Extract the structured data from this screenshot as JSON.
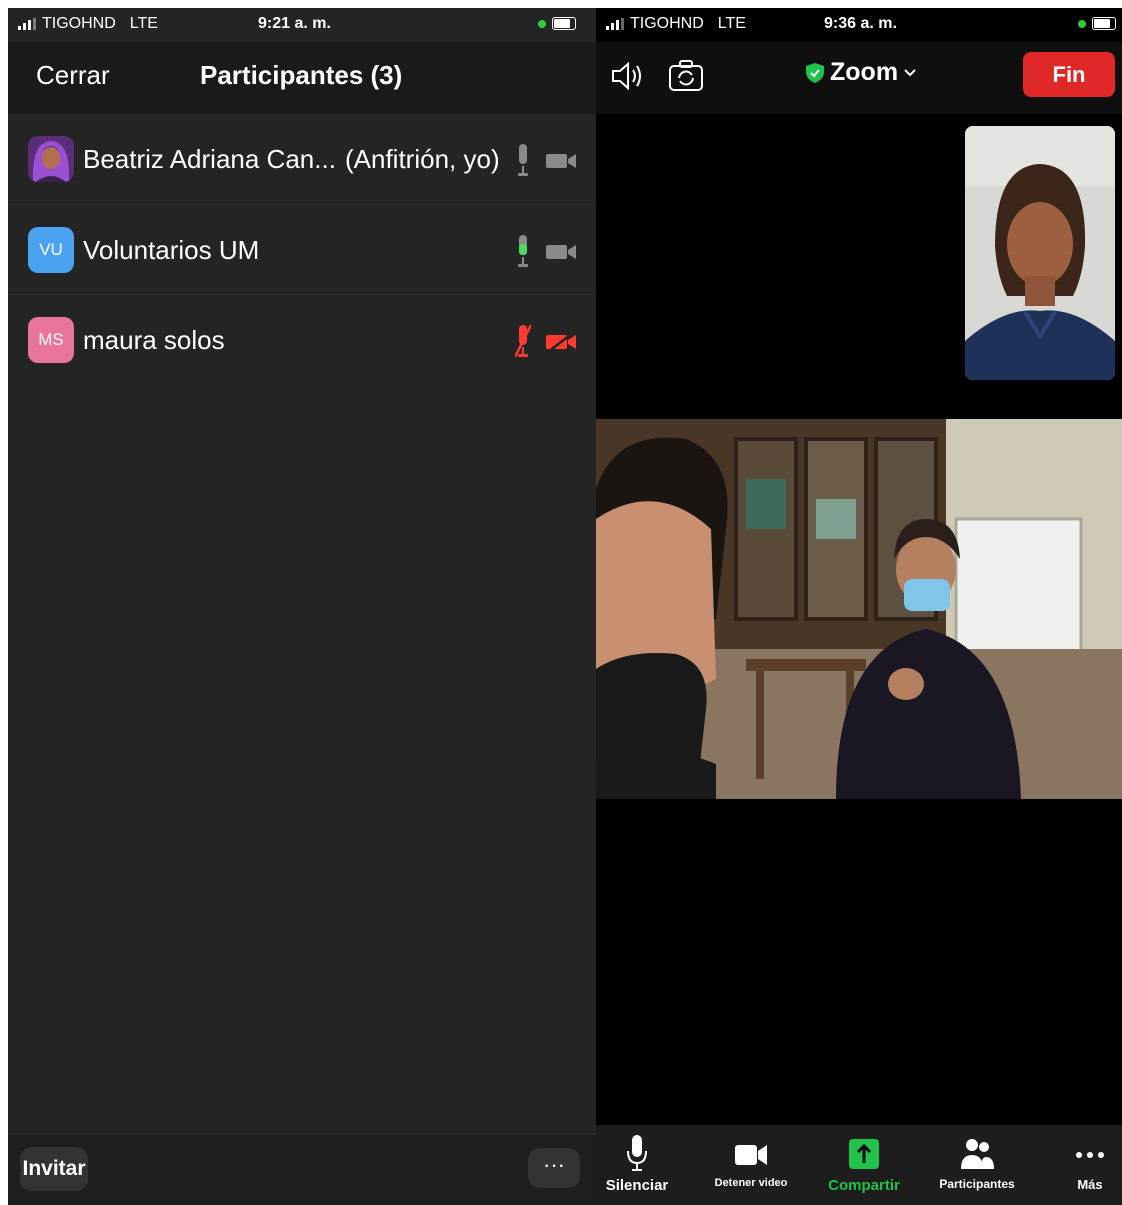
{
  "left": {
    "status": {
      "carrier": "TIGOHND",
      "network": "LTE",
      "time": "9:21 a. m."
    },
    "header": {
      "close_label": "Cerrar",
      "title": "Participantes (3)"
    },
    "participants": [
      {
        "initials": "",
        "name": "Beatriz Adriana Can...",
        "role": "(Anfitrión, yo)",
        "mic": "on",
        "video": "on",
        "avatar_color": "#7b3fa0"
      },
      {
        "initials": "VU",
        "name": "Voluntarios UM",
        "role": "",
        "mic": "active",
        "video": "on",
        "avatar_color": "#4aa3f0"
      },
      {
        "initials": "MS",
        "name": "maura solos",
        "role": "",
        "mic": "muted",
        "video": "off",
        "avatar_color": "#e8749c"
      }
    ],
    "footer": {
      "invite_label": "Invitar",
      "more_label": "···"
    }
  },
  "right": {
    "status": {
      "carrier": "TIGOHND",
      "network": "LTE",
      "time": "9:36 a. m."
    },
    "topbar": {
      "meeting_label": "Zoom",
      "end_label": "Fin"
    },
    "toolbar": {
      "mute": "Silenciar",
      "stop_video": "Detener video",
      "share": "Compartir",
      "participants": "Participantes",
      "more": "Más"
    }
  },
  "colors": {
    "accent_green": "#21c24a",
    "danger_red": "#e02828",
    "mic_green": "#4cd964",
    "muted_red": "#ff3b30"
  }
}
